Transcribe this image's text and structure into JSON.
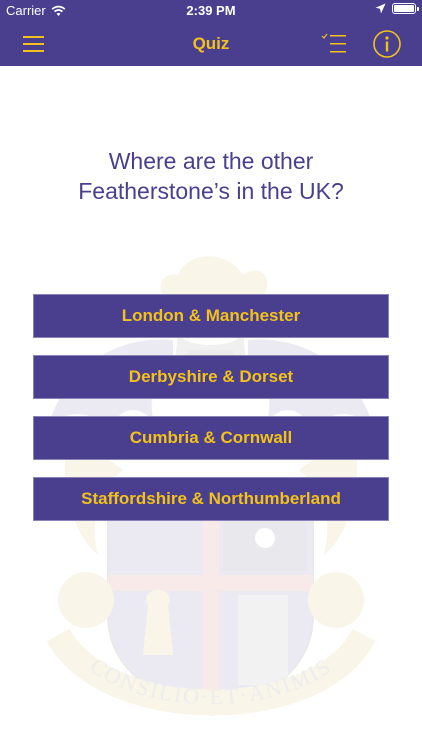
{
  "status_bar": {
    "carrier": "Carrier",
    "time": "2:39 PM",
    "battery_level": 1.0
  },
  "nav": {
    "title": "Quiz",
    "icons": [
      "menu-icon",
      "checklist-icon",
      "info-icon"
    ]
  },
  "question": "Where are the other Featherstone’s in the UK?",
  "answers": [
    "London & Manchester",
    "Derbyshire & Dorset",
    "Cumbria & Cornwall",
    "Staffordshire & Northumberland"
  ],
  "crest": {
    "motto": "CONSILIO·ET·ANIMIS"
  },
  "colors": {
    "primary": "#4a3f8f",
    "accent": "#f2c21a",
    "background": "#ffffff"
  }
}
